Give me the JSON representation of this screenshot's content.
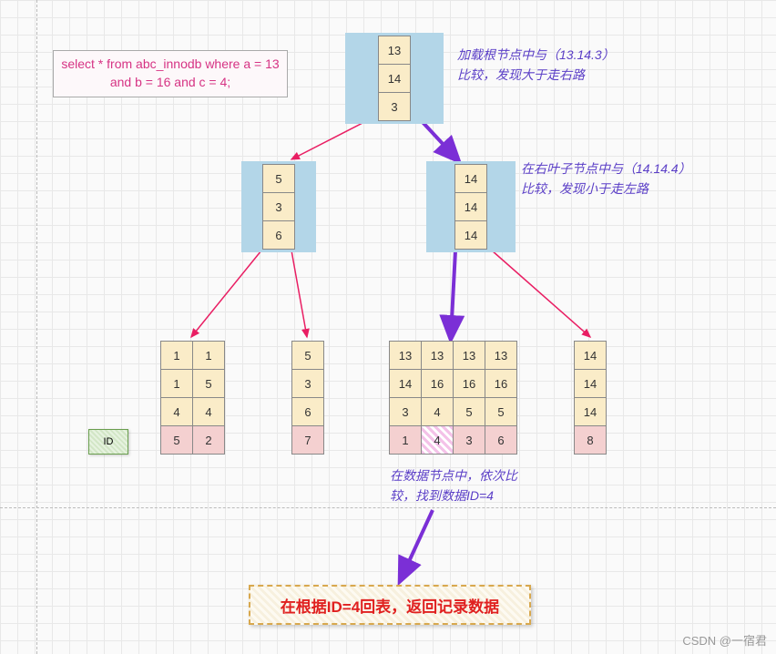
{
  "sql": "select * from abc_innodb where a = 13 and b = 16 and c = 4;",
  "annotations": {
    "root": "加载根节点中与（13.14.3）\n比较，发现大于走右路",
    "rightChild": "在右叶子节点中与（14.14.4）\n比较，发现小于走左路",
    "dataNode": "在数据节点中，依次比\n较，找到数据ID=4"
  },
  "root": {
    "cells": [
      "13",
      "14",
      "3"
    ]
  },
  "leftChild": {
    "cells": [
      "5",
      "3",
      "6"
    ]
  },
  "rightChild": {
    "cells": [
      "14",
      "14",
      "14"
    ]
  },
  "leaf1": {
    "cols": [
      [
        "1",
        "1",
        "4",
        "5"
      ],
      [
        "1",
        "5",
        "4",
        "2"
      ]
    ]
  },
  "leaf2": {
    "cols": [
      [
        "5",
        "3",
        "6",
        "7"
      ]
    ]
  },
  "leaf3": {
    "cols": [
      [
        "13",
        "14",
        "3",
        "1"
      ],
      [
        "13",
        "16",
        "4",
        "4"
      ],
      [
        "13",
        "16",
        "5",
        "3"
      ],
      [
        "13",
        "16",
        "5",
        "6"
      ]
    ]
  },
  "leaf4": {
    "cols": [
      [
        "14",
        "14",
        "14",
        "8"
      ]
    ]
  },
  "idLegend": "ID",
  "result": "在根据ID=4回表，返回记录数据",
  "watermark": "CSDN @一宿君",
  "chart_data": {
    "type": "diagram",
    "description": "B+Tree composite index (a,b,c) lookup",
    "query": "select * from abc_innodb where a = 13 and b = 16 and c = 4;",
    "tree": {
      "root": {
        "key": [
          13,
          14,
          3
        ]
      },
      "children": [
        {
          "key": [
            5,
            3,
            6
          ],
          "leaves": [
            [
              [
                1,
                1,
                4,
                5
              ],
              [
                1,
                5,
                4,
                2
              ]
            ],
            [
              [
                5,
                3,
                6,
                7
              ]
            ]
          ]
        },
        {
          "key": [
            14,
            14,
            14
          ],
          "leaves": [
            [
              [
                13,
                14,
                3,
                1
              ],
              [
                13,
                16,
                4,
                4
              ],
              [
                13,
                16,
                5,
                3
              ],
              [
                13,
                16,
                5,
                6
              ]
            ],
            [
              [
                14,
                14,
                14,
                8
              ]
            ]
          ]
        }
      ]
    },
    "matched_id": 4,
    "result_text": "在根据ID=4回表，返回记录数据"
  }
}
